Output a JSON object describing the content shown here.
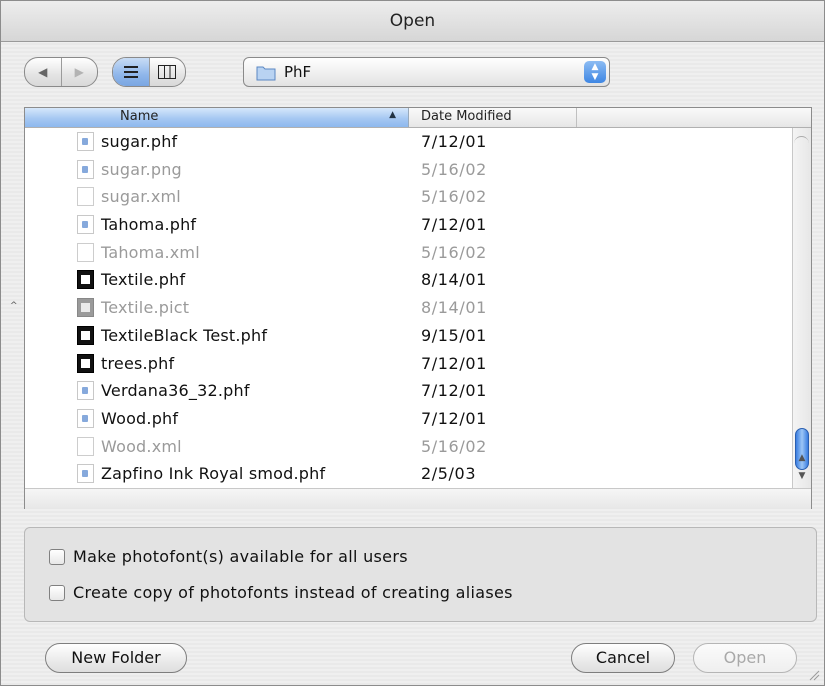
{
  "window": {
    "title": "Open"
  },
  "toolbar": {
    "back_icon": "left-arrow",
    "forward_icon": "right-arrow",
    "list_view_icon": "list-lines",
    "column_view_icon": "columns",
    "location": "PhF"
  },
  "columns": {
    "name": "Name",
    "date_modified": "Date Modified"
  },
  "files": [
    {
      "name": "sugar.phf",
      "date": "7/12/01",
      "icon": "doc",
      "enabled": true
    },
    {
      "name": "sugar.png",
      "date": "5/16/02",
      "icon": "doc",
      "enabled": false
    },
    {
      "name": "sugar.xml",
      "date": "5/16/02",
      "icon": "blank",
      "enabled": false
    },
    {
      "name": "Tahoma.phf",
      "date": "7/12/01",
      "icon": "doc",
      "enabled": true
    },
    {
      "name": "Tahoma.xml",
      "date": "5/16/02",
      "icon": "blank",
      "enabled": false
    },
    {
      "name": "Textile.phf",
      "date": "8/14/01",
      "icon": "black",
      "enabled": true
    },
    {
      "name": "Textile.pict",
      "date": "8/14/01",
      "icon": "gray",
      "enabled": false
    },
    {
      "name": "TextileBlack Test.phf",
      "date": "9/15/01",
      "icon": "black",
      "enabled": true
    },
    {
      "name": "trees.phf",
      "date": "7/12/01",
      "icon": "black",
      "enabled": true
    },
    {
      "name": "Verdana36_32.phf",
      "date": "7/12/01",
      "icon": "doc",
      "enabled": true
    },
    {
      "name": "Wood.phf",
      "date": "7/12/01",
      "icon": "doc",
      "enabled": true
    },
    {
      "name": "Wood.xml",
      "date": "5/16/02",
      "icon": "blank",
      "enabled": false
    },
    {
      "name": "Zapfino Ink Royal smod.phf",
      "date": "2/5/03",
      "icon": "doc",
      "enabled": true
    }
  ],
  "options": {
    "available_all_users": {
      "label": "Make photofont(s) available for all users",
      "checked": false
    },
    "create_copy": {
      "label": "Create copy of photofonts instead of creating aliases",
      "checked": false
    }
  },
  "buttons": {
    "new_folder": "New Folder",
    "cancel": "Cancel",
    "open": "Open"
  },
  "colors": {
    "accent": "#3e86e3",
    "disabled_text": "#9a9a9a"
  }
}
